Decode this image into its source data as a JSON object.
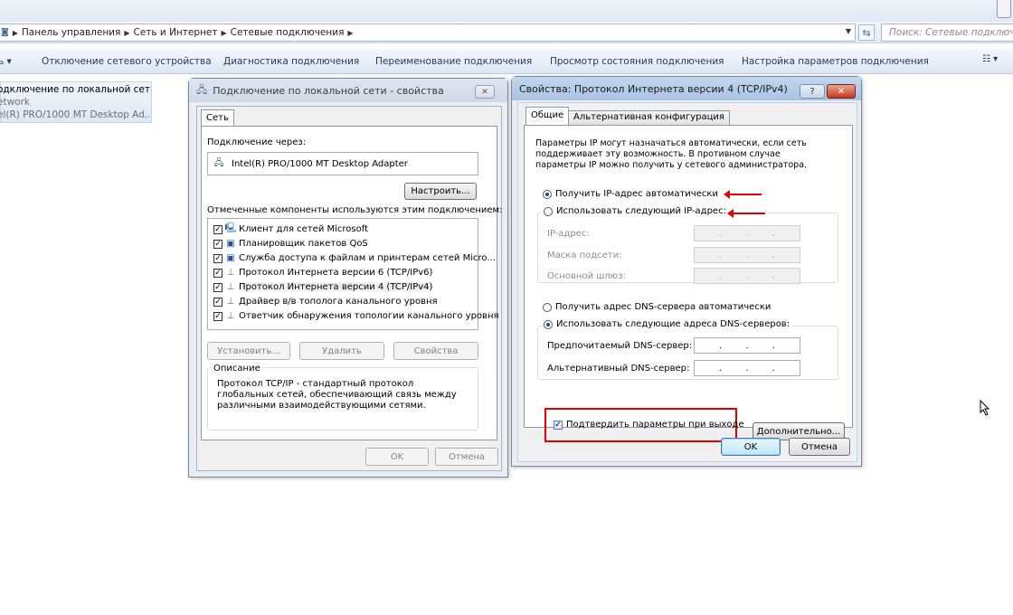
{
  "explorer": {
    "breadcrumb": [
      "Панель управления",
      "Сеть и Интернет",
      "Сетевые подключения"
    ],
    "search_placeholder": "Поиск: Сетевые подключения",
    "toolbar": {
      "organize": "ь ▾",
      "disconnect": "Отключение сетевого устройства",
      "diagnose": "Диагностика подключения",
      "rename": "Переименование подключения",
      "view_status": "Просмотр состояния подключения",
      "settings": "Настройка параметров подключения"
    },
    "connection_item": {
      "name": "одключение по локальной сети",
      "network": "etwork",
      "adapter": "el(R) PRO/1000 MT Desktop Ad..."
    }
  },
  "props_dialog": {
    "title": "Подключение по локальной сети - свойства",
    "tab": "Сеть",
    "connect_using_label": "Подключение через:",
    "adapter_name": "Intel(R) PRO/1000 MT Desktop Adapter",
    "configure_button": "Настроить...",
    "components_label": "Отмеченные компоненты используются этим подключением:",
    "components": [
      {
        "label": "Клиент для сетей Microsoft",
        "icon": "network-client-icon"
      },
      {
        "label": "Планировщик пакетов QoS",
        "icon": "network-service-icon"
      },
      {
        "label": "Служба доступа к файлам и принтерам сетей Micro...",
        "icon": "network-service-icon"
      },
      {
        "label": "Протокол Интернета версии 6 (TCP/IPv6)",
        "icon": "protocol-icon"
      },
      {
        "label": "Протокол Интернета версии 4 (TCP/IPv4)",
        "icon": "protocol-icon"
      },
      {
        "label": "Драйвер в/в тополога канального уровня",
        "icon": "protocol-icon"
      },
      {
        "label": "Ответчик обнаружения топологии канального уровня",
        "icon": "protocol-icon"
      }
    ],
    "install_button": "Установить...",
    "uninstall_button": "Удалить",
    "properties_button": "Свойства",
    "description_title": "Описание",
    "description_text": "Протокол TCP/IP - стандартный протокол глобальных сетей, обеспечивающий связь между различными взаимодействующими сетями.",
    "ok": "OK",
    "cancel": "Отмена"
  },
  "ipv4_dialog": {
    "title": "Свойства: Протокол Интернета версии 4 (TCP/IPv4)",
    "help": "?",
    "tabs": [
      "Общие",
      "Альтернативная конфигурация"
    ],
    "intro": "Параметры IP могут назначаться автоматически, если сеть поддерживает эту возможность. В противном случае параметры IP можно получить у сетевого администратора.",
    "radio_ip_auto": "Получить IP-адрес автоматически",
    "radio_ip_manual": "Использовать следующий IP-адрес:",
    "ip_address_label": "IP-адрес:",
    "subnet_label": "Маска подсети:",
    "gateway_label": "Основной шлюз:",
    "radio_dns_auto": "Получить адрес DNS-сервера автоматически",
    "radio_dns_manual": "Использовать следующие адреса DNS-серверов:",
    "preferred_dns_label": "Предпочитаемый DNS-сервер:",
    "alternate_dns_label": "Альтернативный DNS-сервер:",
    "validate_checkbox": "Подтвердить параметры при выходе",
    "advanced_button": "Дополнительно...",
    "ok": "OK",
    "cancel": "Отмена"
  },
  "colors": {
    "annotation_red": "#e00000",
    "title_bar_active": "#a9c3e2"
  }
}
